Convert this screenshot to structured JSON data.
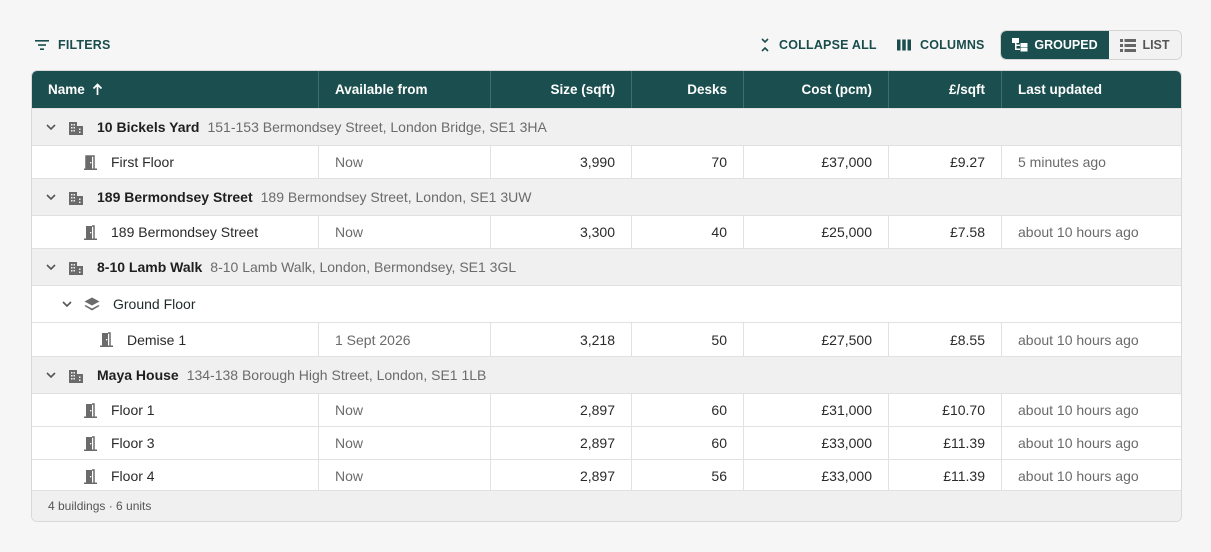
{
  "toolbar": {
    "filters_label": "FILTERS",
    "collapse_label": "COLLAPSE ALL",
    "columns_label": "COLUMNS",
    "view_grouped_label": "GROUPED",
    "view_list_label": "LIST",
    "active_view": "GROUPED"
  },
  "colors": {
    "accent": "#1b4e4e",
    "group_bg": "#f0f0f0"
  },
  "table": {
    "columns": [
      {
        "label": "Name",
        "sort": "ascending"
      },
      {
        "label": "Available from"
      },
      {
        "label": "Size (sqft)"
      },
      {
        "label": "Desks"
      },
      {
        "label": "Cost (pcm)"
      },
      {
        "label": "£/sqft"
      },
      {
        "label": "Last updated"
      }
    ],
    "groups": [
      {
        "name": "10 Bickels Yard",
        "address": "151-153 Bermondsey Street, London Bridge, SE1 3HA",
        "units": [
          {
            "name": "First Floor",
            "available": "Now",
            "size": "3,990",
            "desks": "70",
            "cost": "£37,000",
            "per_sqft": "£9.27",
            "updated": "5 minutes ago"
          }
        ]
      },
      {
        "name": "189 Bermondsey Street",
        "address": "189 Bermondsey Street, London, SE1 3UW",
        "units": [
          {
            "name": "189 Bermondsey Street",
            "available": "Now",
            "size": "3,300",
            "desks": "40",
            "cost": "£25,000",
            "per_sqft": "£7.58",
            "updated": "about 10 hours ago"
          }
        ]
      },
      {
        "name": "8-10 Lamb Walk",
        "address": "8-10 Lamb Walk, London, Bermondsey, SE1 3GL",
        "floor": "Ground Floor",
        "units": [
          {
            "name": "Demise 1",
            "available": "1 Sept 2026",
            "size": "3,218",
            "desks": "50",
            "cost": "£27,500",
            "per_sqft": "£8.55",
            "updated": "about 10 hours ago"
          }
        ]
      },
      {
        "name": "Maya House",
        "address": "134-138 Borough High Street, London, SE1 1LB",
        "units": [
          {
            "name": "Floor 1",
            "available": "Now",
            "size": "2,897",
            "desks": "60",
            "cost": "£31,000",
            "per_sqft": "£10.70",
            "updated": "about 10 hours ago"
          },
          {
            "name": "Floor 3",
            "available": "Now",
            "size": "2,897",
            "desks": "60",
            "cost": "£33,000",
            "per_sqft": "£11.39",
            "updated": "about 10 hours ago"
          },
          {
            "name": "Floor 4",
            "available": "Now",
            "size": "2,897",
            "desks": "56",
            "cost": "£33,000",
            "per_sqft": "£11.39",
            "updated": "about 10 hours ago"
          }
        ]
      }
    ],
    "footer": "4 buildings · 6 units"
  },
  "icons": {
    "filters": "filter-lines-icon",
    "collapse": "collapse-arrows-icon",
    "columns": "columns-icon",
    "grouped": "tree-icon",
    "list": "list-icon",
    "sort": "arrow-up-icon",
    "expand": "chevron-down-icon",
    "building": "building-icon",
    "unit": "door-icon",
    "floor": "layers-icon"
  }
}
